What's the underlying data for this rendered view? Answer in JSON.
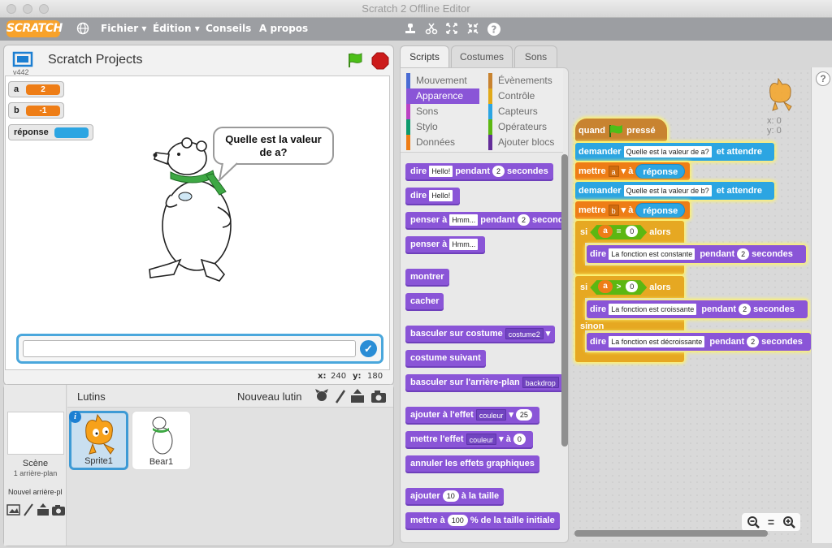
{
  "window": {
    "title": "Scratch 2 Offline Editor"
  },
  "menu": {
    "logo": "SCRATCH",
    "file": "Fichier ▾",
    "edit": "Édition ▾",
    "tips": "Conseils",
    "about": "A propos"
  },
  "stage": {
    "title": "Scratch Projects",
    "version": "v442",
    "x_label": "x:",
    "x_val": "240",
    "y_label": "y:",
    "y_val": "180"
  },
  "variables": [
    {
      "name": "a",
      "value": "2"
    },
    {
      "name": "b",
      "value": "-1"
    },
    {
      "name": "réponse",
      "value": ""
    }
  ],
  "bubble": {
    "line1": "Quelle est la valeur",
    "line2": "de a?"
  },
  "sprites_panel": {
    "title": "Lutins",
    "new_sprite": "Nouveau lutin",
    "scene": "Scène",
    "backdrops": "1 arrière-plan",
    "new_backdrop": "Nouvel arrière-pl",
    "sprites": [
      "Sprite1",
      "Bear1"
    ]
  },
  "tabs": [
    "Scripts",
    "Costumes",
    "Sons"
  ],
  "categories": {
    "left": [
      "Mouvement",
      "Apparence",
      "Sons",
      "Stylo",
      "Données"
    ],
    "right": [
      "Évènements",
      "Contrôle",
      "Capteurs",
      "Opérateurs",
      "Ajouter blocs"
    ],
    "colors_left": [
      "#4a6cd4",
      "#8a55d7",
      "#bb42c3",
      "#0e9a6c",
      "#ee7d16"
    ],
    "colors_right": [
      "#c88330",
      "#e1a91a",
      "#2ca5e2",
      "#5cb712",
      "#632d99"
    ]
  },
  "palette": {
    "say_for": {
      "a": "dire",
      "b": "Hello!",
      "c": "pendant",
      "d": "2",
      "e": "secondes"
    },
    "say": {
      "a": "dire",
      "b": "Hello!"
    },
    "think_for": {
      "a": "penser à",
      "b": "Hmm...",
      "c": "pendant",
      "d": "2",
      "e": "seconde"
    },
    "think": {
      "a": "penser à",
      "b": "Hmm..."
    },
    "show": "montrer",
    "hide": "cacher",
    "switch_costume": {
      "a": "basculer sur costume",
      "b": "costume2"
    },
    "next_costume": "costume suivant",
    "switch_backdrop": {
      "a": "basculer sur l'arrière-plan",
      "b": "backdrop"
    },
    "change_effect": {
      "a": "ajouter à l'effet",
      "b": "couleur",
      "c": "25"
    },
    "set_effect": {
      "a": "mettre l'effet",
      "b": "couleur",
      "c": "à",
      "d": "0"
    },
    "clear_effects": "annuler les effets graphiques",
    "change_size": {
      "a": "ajouter",
      "b": "10",
      "c": "à la taille"
    },
    "set_size": {
      "a": "mettre à",
      "b": "100",
      "c": "% de la taille initiale"
    }
  },
  "script": {
    "hat": {
      "a": "quand",
      "b": "pressé"
    },
    "ask1": {
      "a": "demander",
      "b": "Quelle est la valeur de a?",
      "c": "et attendre"
    },
    "set1": {
      "a": "mettre",
      "b": "a",
      "c": "à",
      "d": "réponse"
    },
    "ask2": {
      "a": "demander",
      "b": "Quelle est la valeur de b?",
      "c": "et attendre"
    },
    "set2": {
      "a": "mettre",
      "b": "b",
      "c": "à",
      "d": "réponse"
    },
    "if1": {
      "a": "si",
      "b": "a",
      "c": "=",
      "d": "0",
      "e": "alors"
    },
    "say1": {
      "a": "dire",
      "b": "La fonction est constante",
      "c": "pendant",
      "d": "2",
      "e": "secondes"
    },
    "if2": {
      "a": "si",
      "b": "a",
      "c": ">",
      "d": "0",
      "e": "alors"
    },
    "say2": {
      "a": "dire",
      "b": "La fonction est croissante",
      "c": "pendant",
      "d": "2",
      "e": "secondes"
    },
    "else": "sinon",
    "say3": {
      "a": "dire",
      "b": "La fonction est décroissante",
      "c": "pendant",
      "d": "2",
      "e": "secondes"
    }
  },
  "sprite_info": {
    "x": "x: 0",
    "y": "y: 0"
  },
  "zoom": {
    "out": "−",
    "reset": "=",
    "in": "+"
  }
}
